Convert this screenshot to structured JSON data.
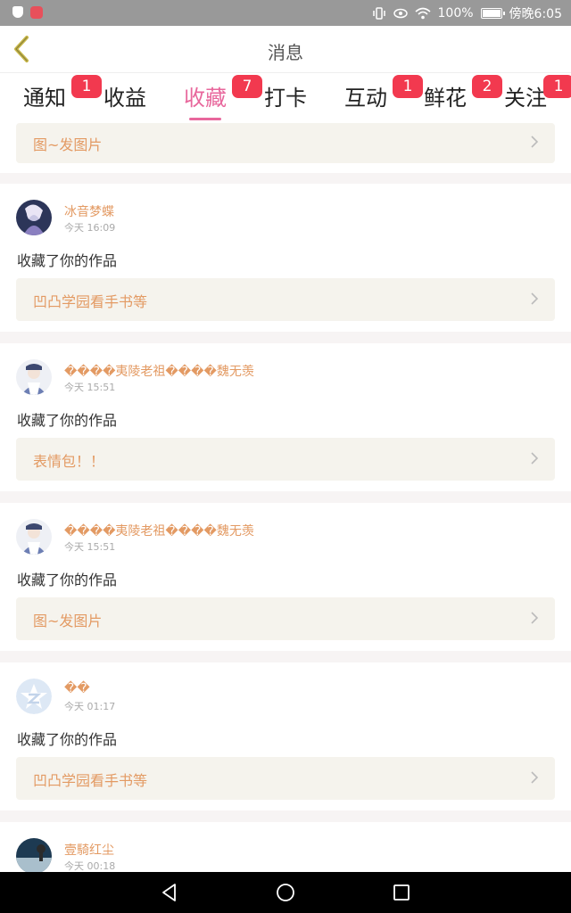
{
  "status_bar": {
    "battery": "100%",
    "time": "傍晚6:05",
    "icons": [
      "shield-icon",
      "app-notification-icon",
      "vibrate-icon",
      "eye-icon",
      "wifi-icon",
      "battery-icon"
    ]
  },
  "header": {
    "title": "消息",
    "back_icon": "chevron-left-icon"
  },
  "tabs": [
    {
      "label": "通知",
      "badge": "1",
      "active": false
    },
    {
      "label": "收益",
      "badge": "",
      "active": false
    },
    {
      "label": "收藏",
      "badge": "7",
      "active": true
    },
    {
      "label": "打卡",
      "badge": "",
      "active": false
    },
    {
      "label": "互动",
      "badge": "1",
      "active": false
    },
    {
      "label": "鲜花",
      "badge": "2",
      "active": false
    },
    {
      "label": "关注",
      "badge": "1",
      "active": false
    }
  ],
  "colors": {
    "accent": "#e8679c",
    "badge": "#f2394f",
    "username": "#e39a63",
    "link_bg": "#f5f3ed"
  },
  "partial_top_card": {
    "work_title": "图~发图片"
  },
  "notifications": [
    {
      "username": "冰音梦蝶",
      "time": "今天 16:09",
      "action": "收藏了你的作品",
      "work_title": "凹凸学园看手书等",
      "avatar": "anime-avatar"
    },
    {
      "username": "����夷陵老祖����魏无羡",
      "time": "今天 15:51",
      "action": "收藏了你的作品",
      "work_title": "表情包！！",
      "avatar": "anime-avatar"
    },
    {
      "username": "����夷陵老祖����魏无羡",
      "time": "今天 15:51",
      "action": "收藏了你的作品",
      "work_title": "图~发图片",
      "avatar": "anime-avatar"
    },
    {
      "username": "��",
      "time": "今天 01:17",
      "action": "收藏了你的作品",
      "work_title": "凹凸学园看手书等",
      "avatar": "default-star-avatar"
    },
    {
      "username": "壹騎红尘",
      "time": "今天 00:18",
      "action": "",
      "work_title": "",
      "avatar": "landscape-avatar"
    }
  ],
  "nav_bar": {
    "buttons": [
      "back-triangle-icon",
      "home-circle-icon",
      "recents-square-icon"
    ]
  }
}
